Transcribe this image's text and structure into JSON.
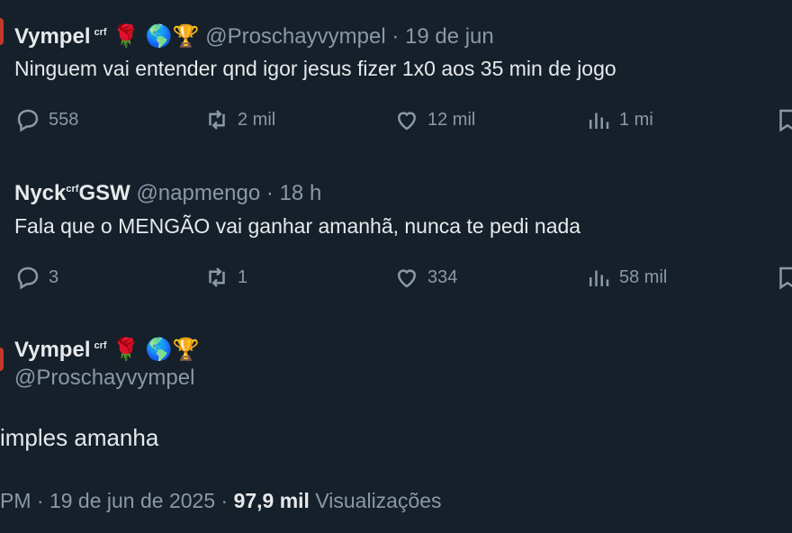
{
  "tweet1": {
    "name": "Vympel",
    "name_badge": "crf",
    "emojis": "🌹 🌎🏆",
    "handle": "@Proschayvympel",
    "time": "19 de jun",
    "text": "Ninguem vai entender qnd igor jesus fizer 1x0 aos 35 min de jogo",
    "replies": "558",
    "retweets": "2 mil",
    "likes": "12 mil",
    "views": "1 mi"
  },
  "tweet2": {
    "name": "Nyck",
    "name_badge": "crf",
    "name_suffix": "GSW",
    "handle": "@napmengo",
    "time": "18 h",
    "text": "Fala que o MENGÃO vai ganhar amanhã, nunca te pedi nada",
    "replies": "3",
    "retweets": "1",
    "likes": "334",
    "views": "58 mil"
  },
  "main": {
    "name": "Vympel",
    "name_badge": "crf",
    "emojis": "🌹 🌎🏆",
    "handle": "@Proschayvympel",
    "text": "imples amanha",
    "time": "PM · 19 de jun de 2025",
    "views_count": "97,9 mil",
    "views_label": "Visualizações"
  },
  "icons": [
    "reply-icon",
    "retweet-icon",
    "like-icon",
    "views-icon",
    "bookmark-icon"
  ]
}
